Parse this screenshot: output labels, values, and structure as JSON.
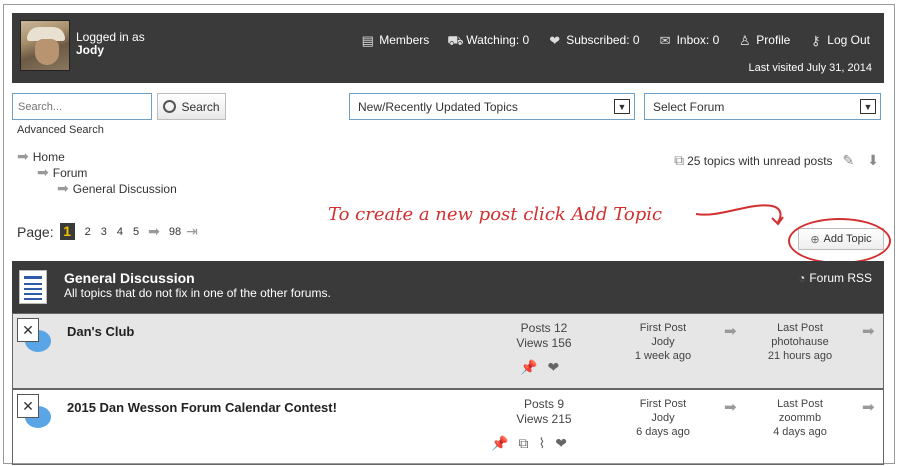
{
  "user": {
    "logged_in_as": "Logged in as",
    "name": "Jody"
  },
  "nav": [
    {
      "icon": "members-icon",
      "glyph": "▤",
      "label": "Members"
    },
    {
      "icon": "watching-icon",
      "glyph": "⛟",
      "label": "Watching: 0"
    },
    {
      "icon": "heart-icon",
      "glyph": "❤",
      "label": "Subscribed: 0"
    },
    {
      "icon": "envelope-icon",
      "glyph": "✉",
      "label": "Inbox: 0"
    },
    {
      "icon": "profile-icon",
      "glyph": "♙",
      "label": "Profile"
    },
    {
      "icon": "key-icon",
      "glyph": "⚷",
      "label": "Log Out"
    }
  ],
  "last_visited": "Last visited July 31, 2014",
  "search": {
    "placeholder": "Search...",
    "button": "Search",
    "advanced": "Advanced Search"
  },
  "topics_select": "New/Recently Updated Topics",
  "forum_select": "Select Forum",
  "breadcrumb": [
    "Home",
    "Forum",
    "General Discussion"
  ],
  "unread": "25 topics with unread posts",
  "pager": {
    "label": "Page:",
    "current": "1",
    "pages": [
      "2",
      "3",
      "4",
      "5"
    ],
    "last": "98"
  },
  "annotation": "To create a new post click Add Topic",
  "add_topic": "Add Topic",
  "forum": {
    "title": "General Discussion",
    "desc": "All topics that do not fix in one of the other forums.",
    "rss": "Forum RSS"
  },
  "topics": [
    {
      "title": "Dan's Club",
      "posts": "Posts 12",
      "views": "Views 156",
      "first_label": "First Post",
      "first_user": "Jody",
      "first_time": "1 week ago",
      "last_label": "Last Post",
      "last_user": "photohause",
      "last_time": "21 hours ago"
    },
    {
      "title": "2015 Dan Wesson Forum Calendar Contest!",
      "posts": "Posts 9",
      "views": "Views 215",
      "first_label": "First Post",
      "first_user": "Jody",
      "first_time": "6 days ago",
      "last_label": "Last Post",
      "last_user": "zoommb",
      "last_time": "4 days ago"
    }
  ]
}
